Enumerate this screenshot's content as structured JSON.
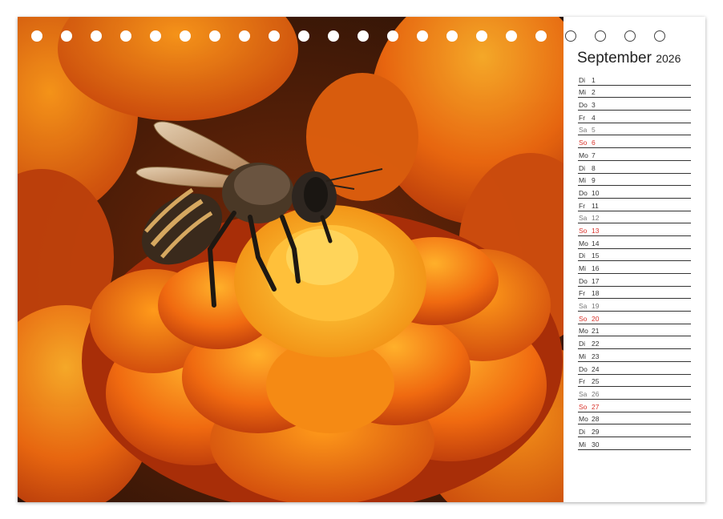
{
  "calendar": {
    "month": "September",
    "year": "2026",
    "days": [
      {
        "wd": "Di",
        "n": "1",
        "type": "weekday"
      },
      {
        "wd": "Mi",
        "n": "2",
        "type": "weekday"
      },
      {
        "wd": "Do",
        "n": "3",
        "type": "weekday"
      },
      {
        "wd": "Fr",
        "n": "4",
        "type": "weekday"
      },
      {
        "wd": "Sa",
        "n": "5",
        "type": "saturday"
      },
      {
        "wd": "So",
        "n": "6",
        "type": "sunday"
      },
      {
        "wd": "Mo",
        "n": "7",
        "type": "weekday"
      },
      {
        "wd": "Di",
        "n": "8",
        "type": "weekday"
      },
      {
        "wd": "Mi",
        "n": "9",
        "type": "weekday"
      },
      {
        "wd": "Do",
        "n": "10",
        "type": "weekday"
      },
      {
        "wd": "Fr",
        "n": "11",
        "type": "weekday"
      },
      {
        "wd": "Sa",
        "n": "12",
        "type": "saturday"
      },
      {
        "wd": "So",
        "n": "13",
        "type": "sunday"
      },
      {
        "wd": "Mo",
        "n": "14",
        "type": "weekday"
      },
      {
        "wd": "Di",
        "n": "15",
        "type": "weekday"
      },
      {
        "wd": "Mi",
        "n": "16",
        "type": "weekday"
      },
      {
        "wd": "Do",
        "n": "17",
        "type": "weekday"
      },
      {
        "wd": "Fr",
        "n": "18",
        "type": "weekday"
      },
      {
        "wd": "Sa",
        "n": "19",
        "type": "saturday"
      },
      {
        "wd": "So",
        "n": "20",
        "type": "sunday"
      },
      {
        "wd": "Mo",
        "n": "21",
        "type": "weekday"
      },
      {
        "wd": "Di",
        "n": "22",
        "type": "weekday"
      },
      {
        "wd": "Mi",
        "n": "23",
        "type": "weekday"
      },
      {
        "wd": "Do",
        "n": "24",
        "type": "weekday"
      },
      {
        "wd": "Fr",
        "n": "25",
        "type": "weekday"
      },
      {
        "wd": "Sa",
        "n": "26",
        "type": "saturday"
      },
      {
        "wd": "So",
        "n": "27",
        "type": "sunday"
      },
      {
        "wd": "Mo",
        "n": "28",
        "type": "weekday"
      },
      {
        "wd": "Di",
        "n": "29",
        "type": "weekday"
      },
      {
        "wd": "Mi",
        "n": "30",
        "type": "weekday"
      }
    ]
  },
  "photo": {
    "subject": "bee-on-marigold",
    "colors": {
      "petal_dark": "#c0360a",
      "petal_mid": "#ee6a10",
      "petal_light": "#ffa21e",
      "center": "#ffb020",
      "background": "#2a1608"
    }
  },
  "binding": {
    "ring_count": 22,
    "ring_color": "#444444"
  },
  "colors": {
    "sunday": "#d8322a",
    "text": "#333333"
  }
}
